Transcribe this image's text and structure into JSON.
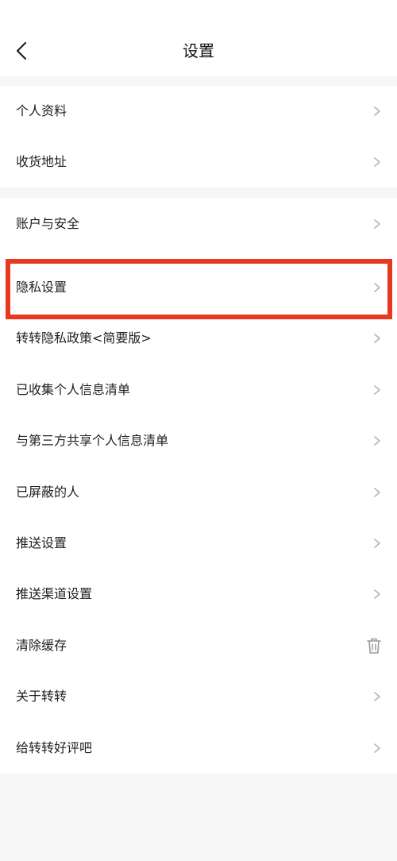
{
  "header": {
    "title": "设置"
  },
  "section1": {
    "items": [
      {
        "label": "个人资料"
      },
      {
        "label": "收货地址"
      }
    ]
  },
  "section2": {
    "items": [
      {
        "label": "账户与安全"
      },
      {
        "label": "隐私设置"
      },
      {
        "label": "转转隐私政策<简要版>"
      },
      {
        "label": "已收集个人信息清单"
      },
      {
        "label": "与第三方共享个人信息清单"
      },
      {
        "label": "已屏蔽的人"
      },
      {
        "label": "推送设置"
      },
      {
        "label": "推送渠道设置"
      },
      {
        "label": "清除缓存",
        "icon": "trash-icon"
      },
      {
        "label": "关于转转"
      },
      {
        "label": "给转转好评吧"
      }
    ]
  },
  "colors": {
    "highlight": "#e8391f",
    "background": "#f6f6f6"
  }
}
